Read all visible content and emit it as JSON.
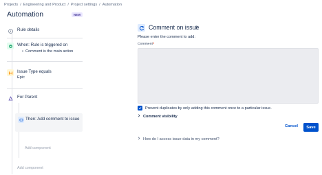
{
  "breadcrumbs": [
    "Projects",
    "Engineering and Product",
    "Project settings",
    "Automation"
  ],
  "page": {
    "title": "Automation",
    "badge": "NEW"
  },
  "rule": {
    "details_label": "Rule details",
    "trigger": {
      "label": "When: Rule is triggered on",
      "detail": "Comment is the main action"
    },
    "condition": {
      "label": "Issue Type equals",
      "value": "Epic"
    },
    "branch": {
      "label": "For Parent"
    },
    "action": {
      "label": "Then: Add comment to issue"
    },
    "add_component_inner": "Add component",
    "add_component_outer": "Add component"
  },
  "editor": {
    "title": "Comment on issue",
    "description": "Please enter the comment to add:",
    "comment_label": "Comment",
    "required_mark": "*",
    "comment_value": "",
    "prevent_duplicates_label": "Prevent duplicates by only adding this comment once to a particular issue.",
    "prevent_duplicates_checked": true,
    "visibility_label": "Comment visibility",
    "cancel_label": "Cancel",
    "save_label": "Save",
    "help_link": "How do I access issue data in my comment?"
  },
  "colors": {
    "primary": "#0052cc",
    "textarea_bg": "#ebecf0"
  }
}
